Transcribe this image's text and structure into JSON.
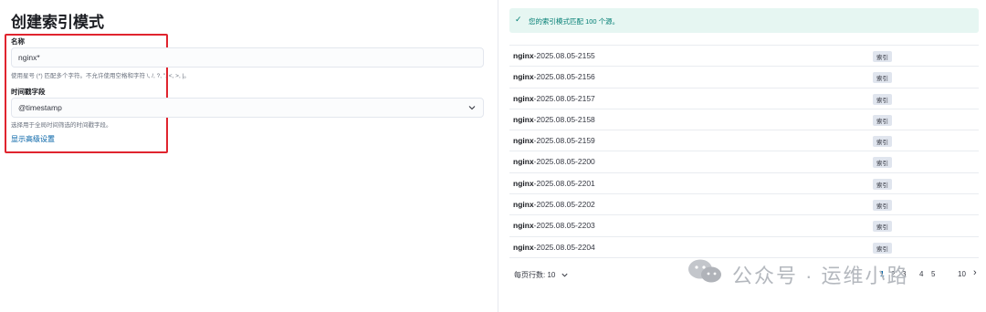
{
  "left": {
    "title": "创建索引模式",
    "name_label": "名称",
    "name_value": "nginx*",
    "name_help": "使用星号 (*) 匹配多个字符。不允许使用空格和字符 \\, /, ?, \", <, >, |。",
    "time_label": "时间戳字段",
    "time_value": "@timestamp",
    "time_help": "选择用于全局时间筛选的时间戳字段。",
    "advanced_link": "显示高级设置"
  },
  "right": {
    "banner_text": "您的索引模式匹配 100 个源。",
    "rows": [
      {
        "prefix": "nginx",
        "suffix": "-2025.08.05-2155",
        "badge": "索引"
      },
      {
        "prefix": "nginx",
        "suffix": "-2025.08.05-2156",
        "badge": "索引"
      },
      {
        "prefix": "nginx",
        "suffix": "-2025.08.05-2157",
        "badge": "索引"
      },
      {
        "prefix": "nginx",
        "suffix": "-2025.08.05-2158",
        "badge": "索引"
      },
      {
        "prefix": "nginx",
        "suffix": "-2025.08.05-2159",
        "badge": "索引"
      },
      {
        "prefix": "nginx",
        "suffix": "-2025.08.05-2200",
        "badge": "索引"
      },
      {
        "prefix": "nginx",
        "suffix": "-2025.08.05-2201",
        "badge": "索引"
      },
      {
        "prefix": "nginx",
        "suffix": "-2025.08.05-2202",
        "badge": "索引"
      },
      {
        "prefix": "nginx",
        "suffix": "-2025.08.05-2203",
        "badge": "索引"
      },
      {
        "prefix": "nginx",
        "suffix": "-2025.08.05-2204",
        "badge": "索引"
      }
    ],
    "rows_per_page": "每页行数: 10",
    "pages": [
      "1",
      "2",
      "3",
      "4",
      "5",
      "10"
    ],
    "next_arrow": "›"
  },
  "watermark": {
    "text": "公众号 · 运维小路",
    "icon": "wechat-icon"
  },
  "colors": {
    "accent": "#0061a6",
    "success": "#017d73",
    "highlight": "#e0242e"
  }
}
